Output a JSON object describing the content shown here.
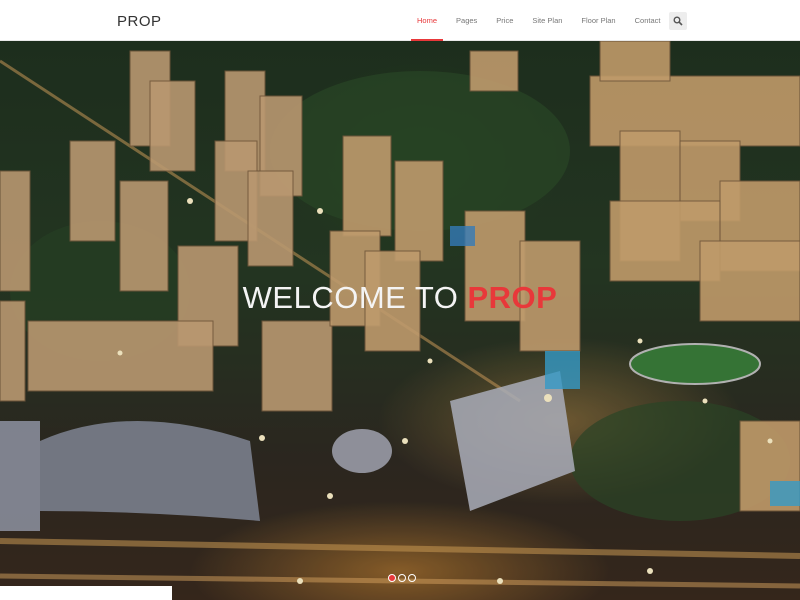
{
  "header": {
    "brand": "PROP",
    "nav": [
      {
        "label": "Home",
        "active": true
      },
      {
        "label": "Pages",
        "active": false
      },
      {
        "label": "Price",
        "active": false
      },
      {
        "label": "Site Plan",
        "active": false
      },
      {
        "label": "Floor Plan",
        "active": false
      },
      {
        "label": "Contact",
        "active": false
      }
    ],
    "search_icon": "search-icon"
  },
  "hero": {
    "headline_prefix": "WELCOME TO",
    "headline_accent": "PROP",
    "accent_color": "#e8383a",
    "slides": 3,
    "active_slide": 1
  }
}
